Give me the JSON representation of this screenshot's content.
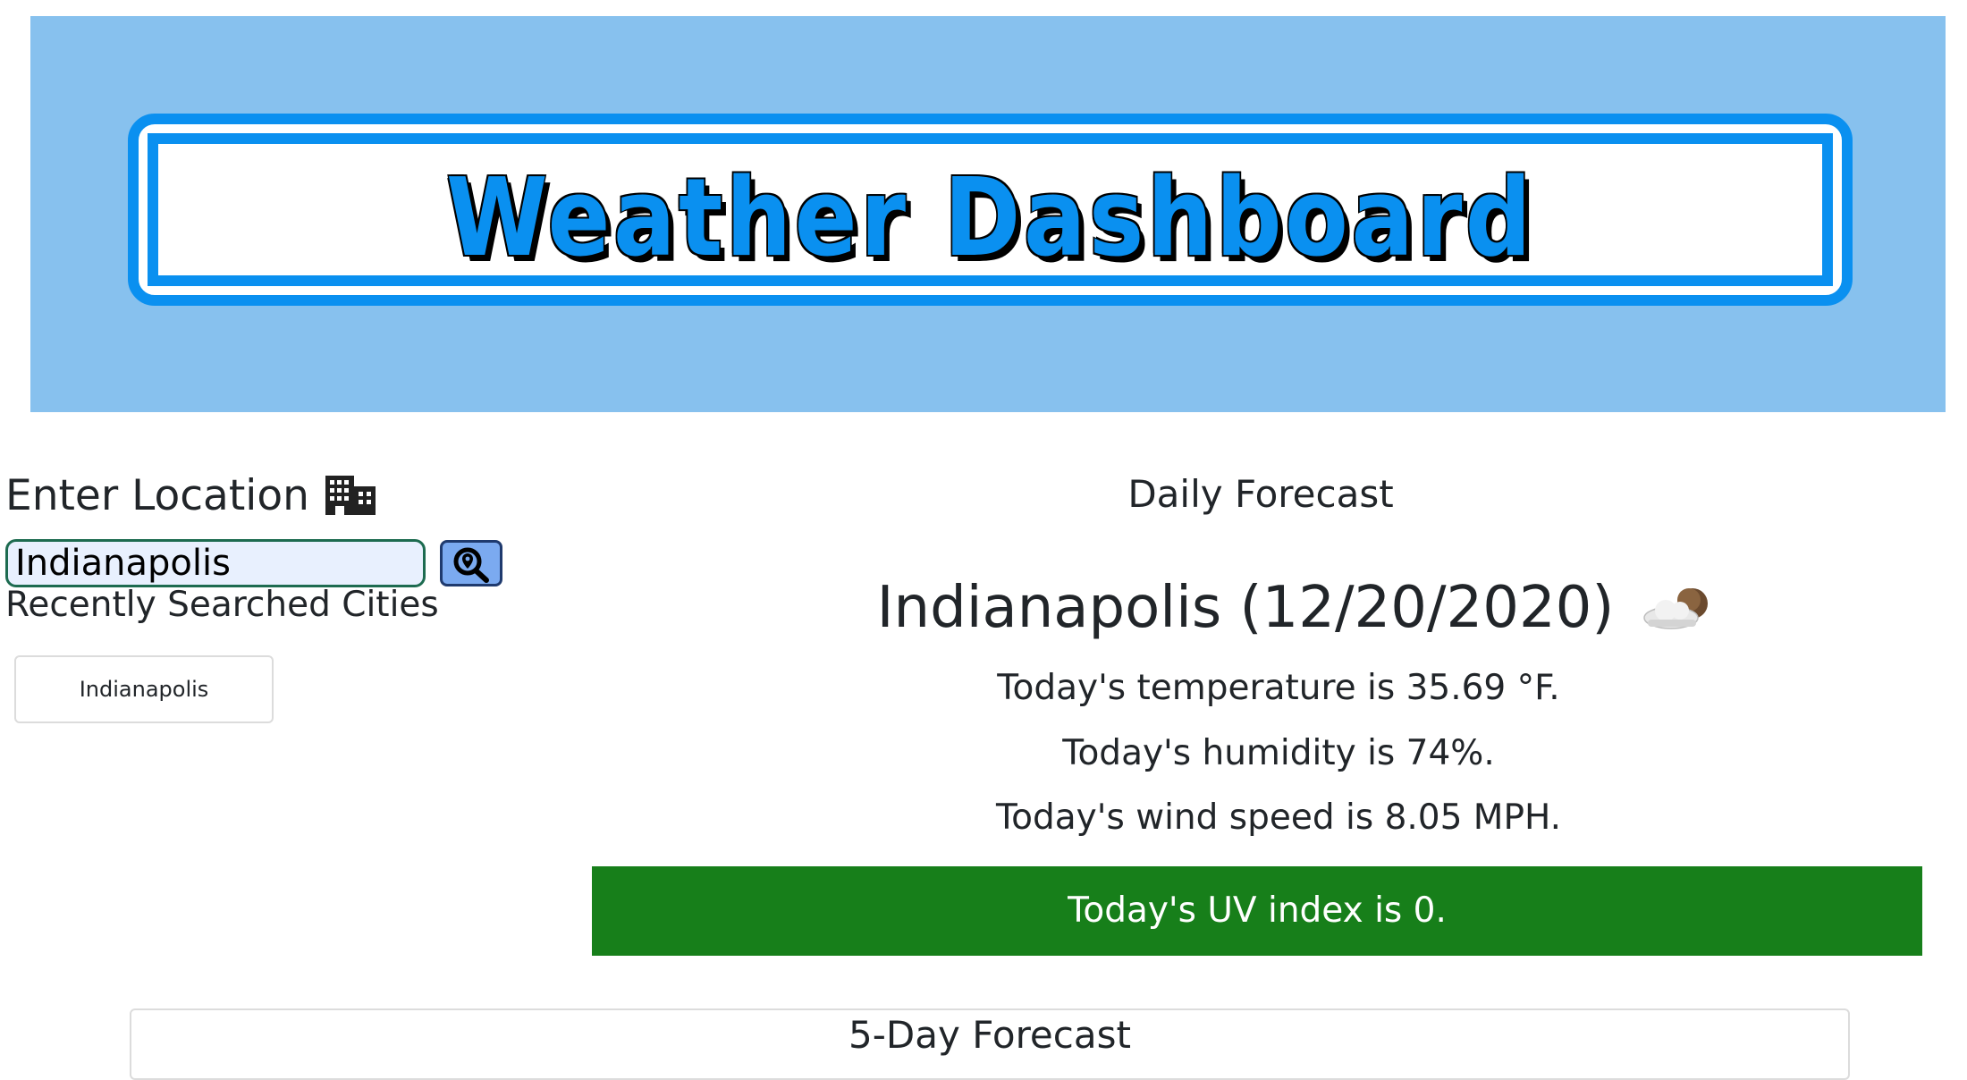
{
  "header": {
    "title": "Weather Dashboard"
  },
  "search": {
    "label": "Enter Location",
    "label_icon": "city-icon",
    "value": "Indianapolis",
    "placeholder": "",
    "button_icon": "search-location-icon"
  },
  "recent": {
    "label": "Recently Searched Cities",
    "items": [
      {
        "label": "Indianapolis"
      }
    ]
  },
  "daily": {
    "heading": "Daily Forecast",
    "city_date": "Indianapolis (12/20/2020)",
    "weather_icon": "partly-cloudy-night-icon",
    "temperature": "Today's temperature is 35.69 °F.",
    "humidity": "Today's humidity is 74%.",
    "wind": "Today's wind speed is 8.05 MPH.",
    "uv": "Today's UV index is 0."
  },
  "five_day": {
    "heading": "5-Day Forecast"
  },
  "colors": {
    "banner_bg": "#87c1ee",
    "accent_blue": "#0a90f0",
    "uv_low": "#177f1a",
    "search_button": "#7baaf0"
  }
}
